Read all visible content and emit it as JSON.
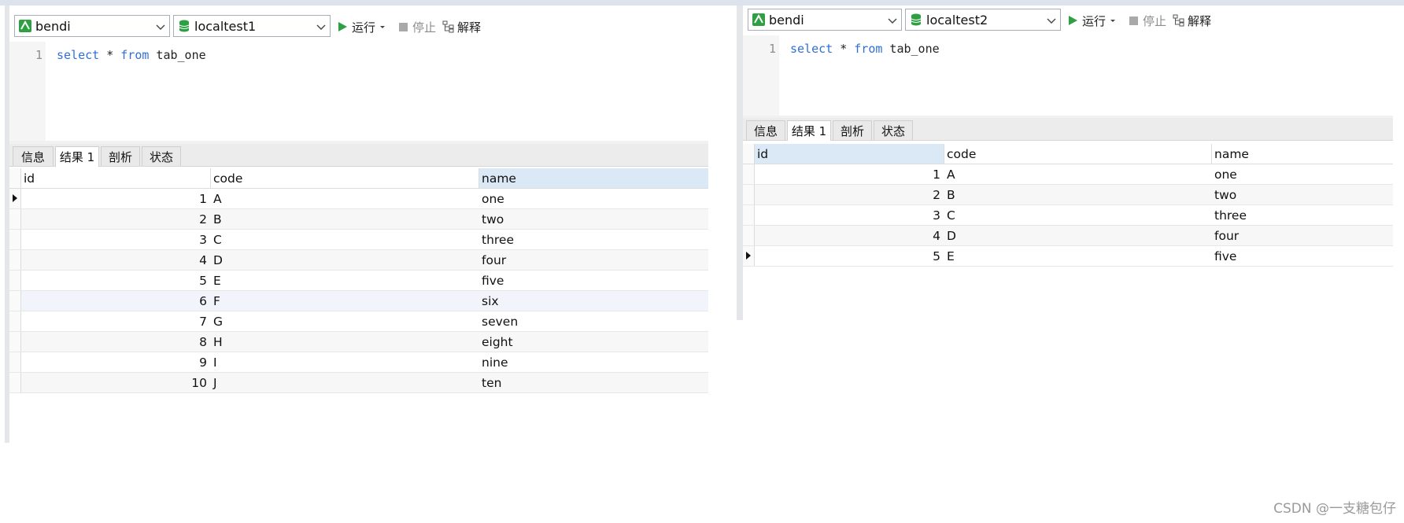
{
  "left_pane": {
    "connection": "bendi",
    "database": "localtest1",
    "toolbar": {
      "run": "运行",
      "stop": "停止",
      "explain": "解释"
    },
    "editor": {
      "line_number": "1",
      "kw1": "select",
      "star": " * ",
      "kw2": "from",
      "table": " tab_one"
    },
    "tabs": [
      "信息",
      "结果 1",
      "剖析",
      "状态"
    ],
    "columns": [
      "id",
      "code",
      "name"
    ],
    "rows": [
      {
        "id": "1",
        "code": "A",
        "name": "one"
      },
      {
        "id": "2",
        "code": "B",
        "name": "two"
      },
      {
        "id": "3",
        "code": "C",
        "name": "three"
      },
      {
        "id": "4",
        "code": "D",
        "name": "four"
      },
      {
        "id": "5",
        "code": "E",
        "name": "five"
      },
      {
        "id": "6",
        "code": "F",
        "name": "six"
      },
      {
        "id": "7",
        "code": "G",
        "name": "seven"
      },
      {
        "id": "8",
        "code": "H",
        "name": "eight"
      },
      {
        "id": "9",
        "code": "I",
        "name": "nine"
      },
      {
        "id": "10",
        "code": "J",
        "name": "ten"
      }
    ]
  },
  "right_pane": {
    "connection": "bendi",
    "database": "localtest2",
    "toolbar": {
      "run": "运行",
      "stop": "停止",
      "explain": "解释"
    },
    "editor": {
      "line_number": "1",
      "kw1": "select",
      "star": " * ",
      "kw2": "from",
      "table": " tab_one"
    },
    "tabs": [
      "信息",
      "结果 1",
      "剖析",
      "状态"
    ],
    "columns": [
      "id",
      "code",
      "name"
    ],
    "rows": [
      {
        "id": "1",
        "code": "A",
        "name": "one"
      },
      {
        "id": "2",
        "code": "B",
        "name": "two"
      },
      {
        "id": "3",
        "code": "C",
        "name": "three"
      },
      {
        "id": "4",
        "code": "D",
        "name": "four"
      },
      {
        "id": "5",
        "code": "E",
        "name": "five"
      }
    ]
  },
  "watermark": "CSDN @一支糖包仔",
  "colors": {
    "accent_green": "#2ea043",
    "keyword_blue": "#2f6fd8",
    "selected_header": "#dbe8f6"
  }
}
